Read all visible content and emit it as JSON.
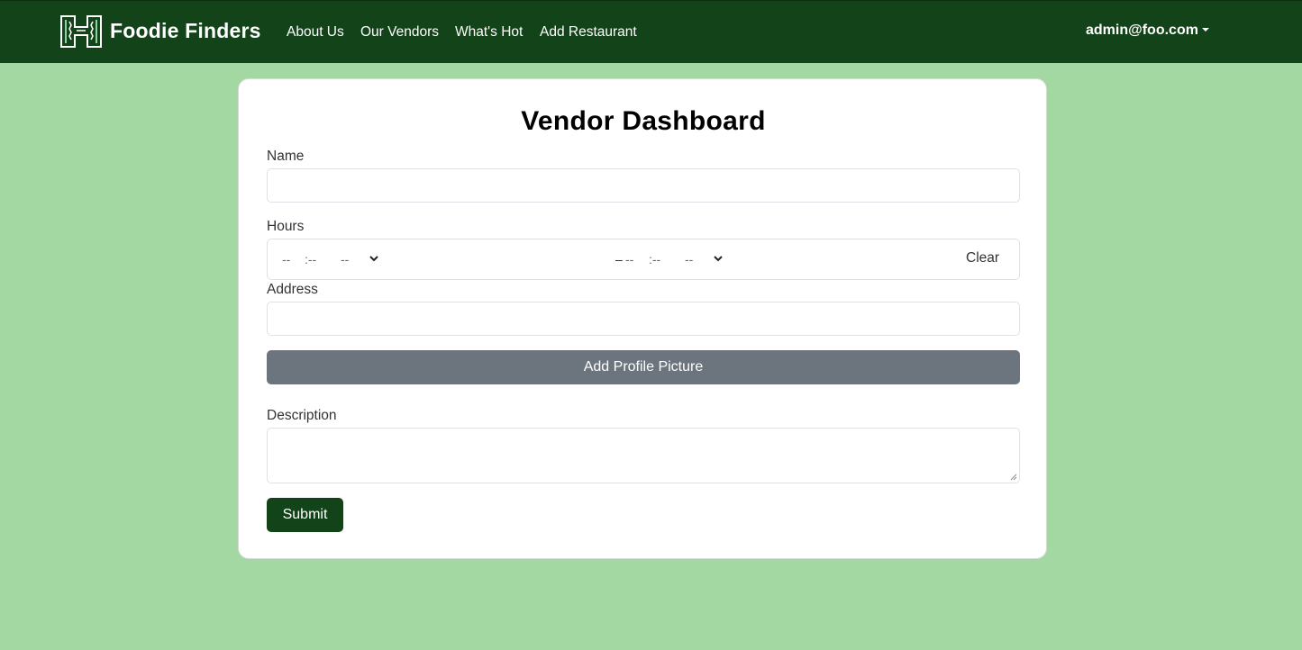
{
  "navbar": {
    "brand": "Foodie Finders",
    "logo_icon": "h-logo-icon",
    "links": [
      "About Us",
      "Our Vendors",
      "What's Hot",
      "Add Restaurant"
    ],
    "user": "admin@foo.com"
  },
  "form": {
    "title": "Vendor Dashboard",
    "name_label": "Name",
    "name_value": "",
    "hours_label": "Hours",
    "hours": {
      "start": {
        "hour": "--",
        "minute": ":--",
        "period": "--"
      },
      "separator": "–",
      "end": {
        "hour": "--",
        "minute": ":--",
        "period": "--"
      },
      "clear_label": "Clear"
    },
    "address_label": "Address",
    "address_value": "",
    "picture_button": "Add Profile Picture",
    "description_label": "Description",
    "description_value": "",
    "submit_label": "Submit"
  },
  "colors": {
    "page_background": "#a3d8a3",
    "navbar": "#134318",
    "secondary_button": "#6c757d",
    "primary_button": "#134318"
  }
}
